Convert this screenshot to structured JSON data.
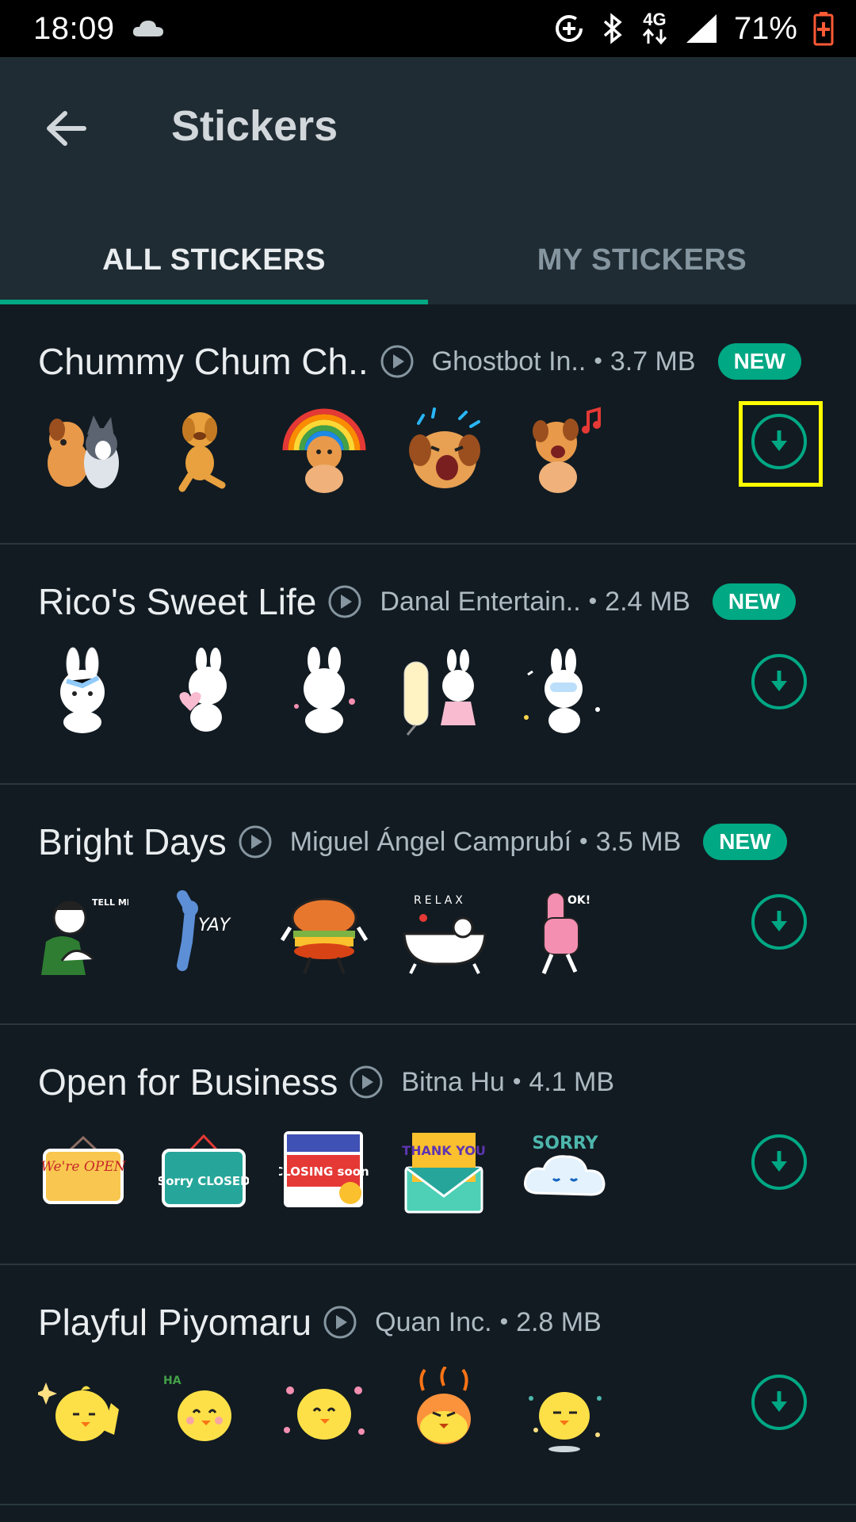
{
  "status_bar": {
    "time": "18:09",
    "network": "4G",
    "battery": "71%",
    "colors": {
      "battery_low": "#ff5a36"
    }
  },
  "app_bar": {
    "title": "Stickers",
    "back_icon": "arrow-left-icon"
  },
  "tabs": [
    {
      "label": "ALL STICKERS",
      "active": true
    },
    {
      "label": "MY STICKERS",
      "active": false
    }
  ],
  "packs": [
    {
      "name": "Chummy Chum Ch..",
      "author": "Ghostbot In..",
      "size": "3.7 MB",
      "badge": "NEW",
      "highlighted": true
    },
    {
      "name": "Rico's Sweet Life",
      "author": "Danal Entertain..",
      "size": "2.4 MB",
      "badge": "NEW"
    },
    {
      "name": "Bright Days",
      "author": "Miguel Ángel Camprubí",
      "size": "3.5 MB",
      "badge": "NEW"
    },
    {
      "name": "Open for Business",
      "author": "Bitna Hu",
      "size": "4.1 MB",
      "badge": ""
    },
    {
      "name": "Playful Piyomaru",
      "author": "Quan Inc.",
      "size": "2.8 MB",
      "badge": ""
    }
  ],
  "sticker_art": {
    "open_sign": "We're OPEN",
    "closed_sign": "Sorry CLOSED",
    "closing_soon": "CLOSING soon",
    "thank_you": "THANK YOU",
    "sorry_cloud": "SORRY",
    "tell_me_more": "TELL ME MORE",
    "yay": "YAY",
    "relax": "RELAX",
    "ok": "OK!",
    "haha": "HA"
  },
  "colors": {
    "accent": "#00a884",
    "background": "#121b22",
    "app_bar": "#202c33",
    "highlight": "#ffff00"
  }
}
